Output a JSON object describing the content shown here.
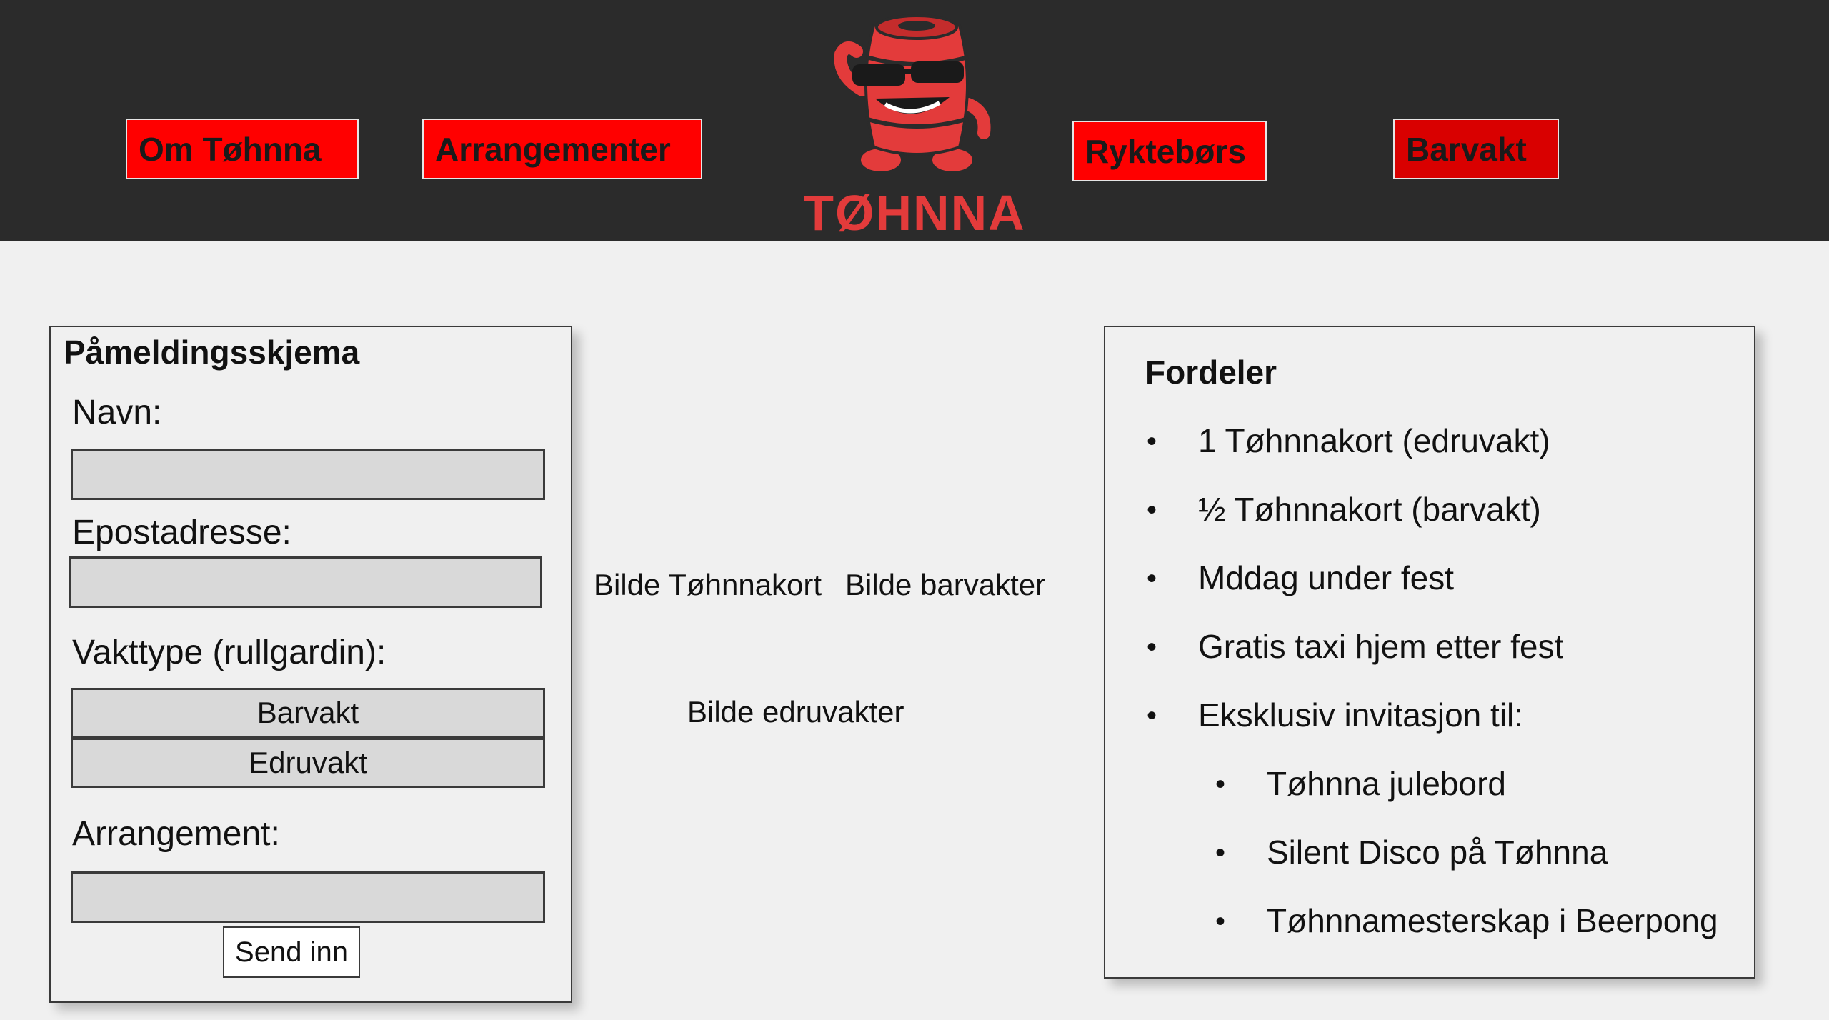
{
  "nav": {
    "items": [
      {
        "label": "Om Tøhnna"
      },
      {
        "label": "Arrangementer"
      },
      {
        "label": "Ryktebørs"
      },
      {
        "label": "Barvakt"
      }
    ],
    "logo_text": "TØHNNA"
  },
  "form": {
    "title": "Påmeldingsskjema",
    "name_label": "Navn:",
    "name_value": "",
    "email_label": "Epostadresse:",
    "email_value": "",
    "shift_label": "Vakttype (rullgardin):",
    "shift_options": [
      "Barvakt",
      "Edruvakt"
    ],
    "event_label": "Arrangement:",
    "event_value": "",
    "submit_label": "Send inn"
  },
  "images": {
    "card": "Bilde Tøhnnakort",
    "bar": "Bilde barvakter",
    "sober": "Bilde edruvakter"
  },
  "benefits": {
    "title": "Fordeler",
    "bullet": "•",
    "items": [
      "1 Tøhnnakort (edruvakt)",
      "½ Tøhnnakort (barvakt)",
      "Mddag under fest",
      "Gratis taxi hjem etter fest",
      "Eksklusiv invitasjon til:"
    ],
    "sub_items": [
      "Tøhnna julebord",
      "Silent Disco på Tøhnna",
      "Tøhnnamesterskap i Beerpong"
    ]
  },
  "colors": {
    "header_bg": "#2b2b2b",
    "nav_button": "#ff0000",
    "logo_red": "#e33b3b",
    "page_bg": "#f0f0f0",
    "field_bg": "#d9d9d9"
  }
}
